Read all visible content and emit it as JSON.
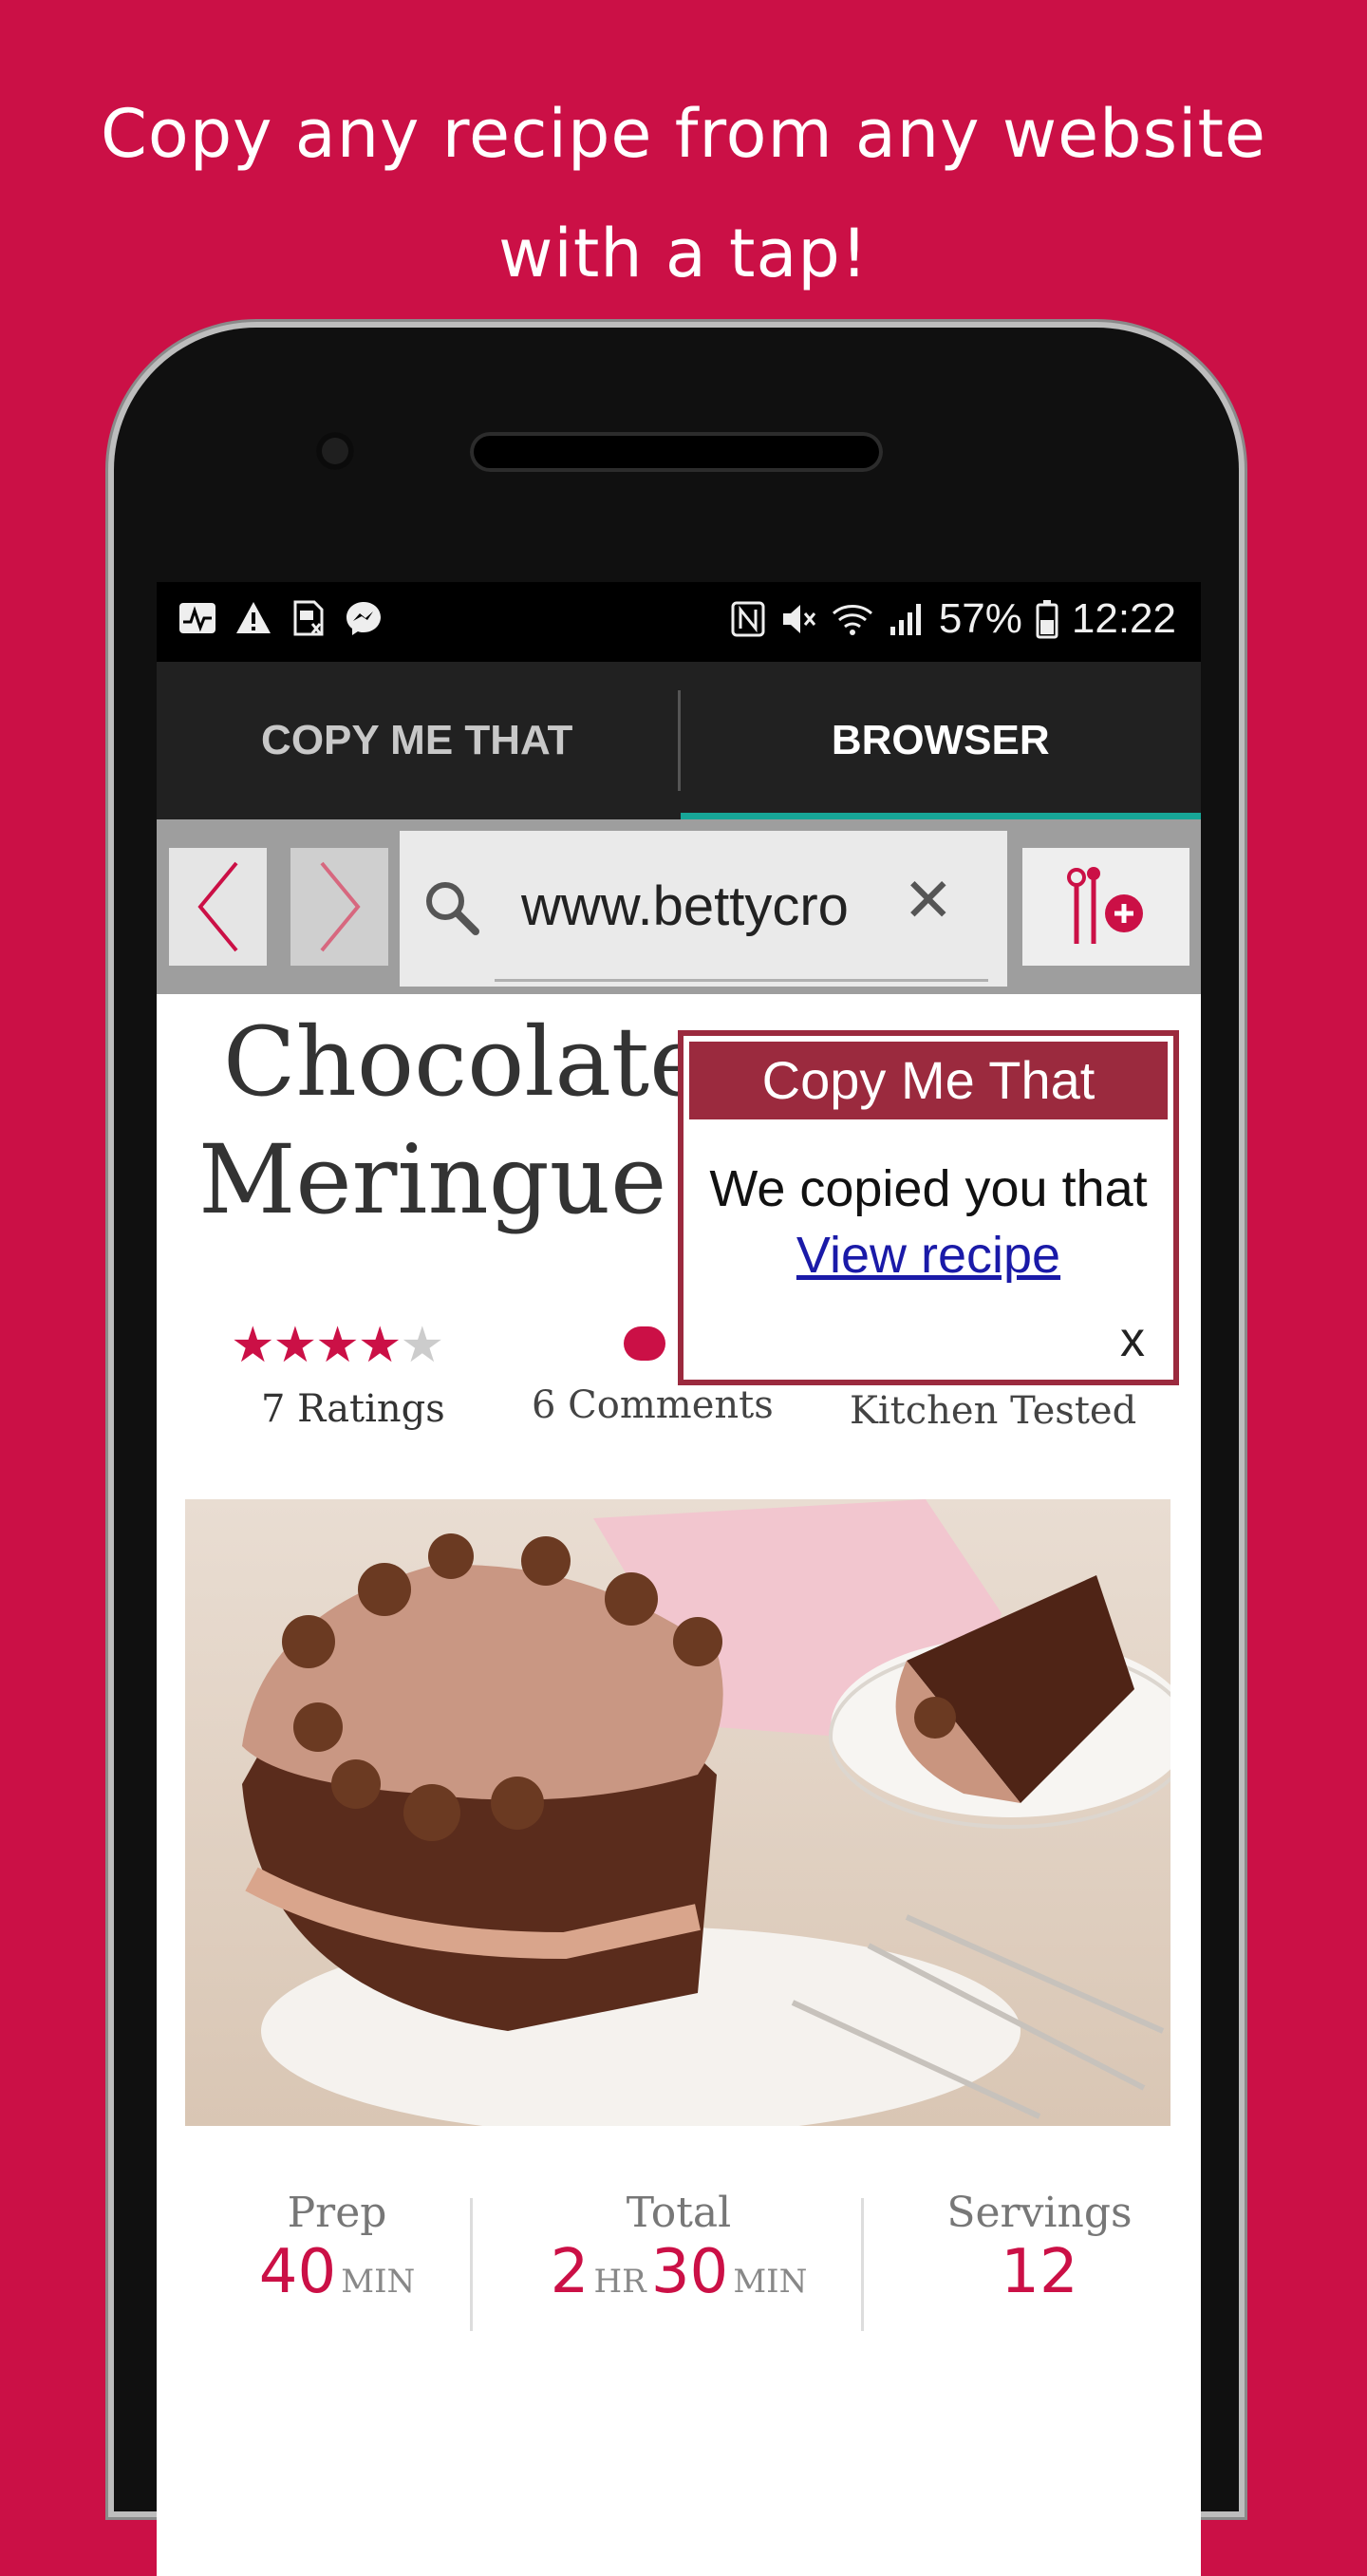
{
  "headline": {
    "line1": "Copy any recipe from any website",
    "line2": "with a tap!"
  },
  "statusbar": {
    "left_icons": [
      "activity-icon",
      "warning-icon",
      "sim-icon",
      "messenger-icon"
    ],
    "right_icons": [
      "nfc-icon",
      "mute-icon",
      "wifi-icon",
      "signal-icon",
      "battery-icon"
    ],
    "battery": "57%",
    "time": "12:22"
  },
  "tabs": [
    {
      "label": "COPY ME THAT",
      "active": false
    },
    {
      "label": "BROWSER",
      "active": true
    }
  ],
  "browser": {
    "url": "www.bettycrocker.com"
  },
  "recipe": {
    "title_line1": "Chocolate",
    "title_line2": "Meringue",
    "rating_stars": 4.5,
    "ratings": "7 Ratings",
    "comments": "6 Comments",
    "kitchen": "Kitchen Tested"
  },
  "popup": {
    "title": "Copy Me That",
    "message": "We copied you that",
    "link": "View recipe",
    "close": "x"
  },
  "times": {
    "prep_label": "Prep",
    "prep_value": "40",
    "prep_unit": "MIN",
    "total_label": "Total",
    "total_hours": "2",
    "total_hr_unit": "HR",
    "total_min": "30",
    "total_min_unit": "MIN",
    "servings_label": "Servings",
    "servings_value": "12"
  },
  "colors": {
    "brand": "#CB1046",
    "popup": "#9b2a3e",
    "tab_indicator": "#17a697"
  }
}
